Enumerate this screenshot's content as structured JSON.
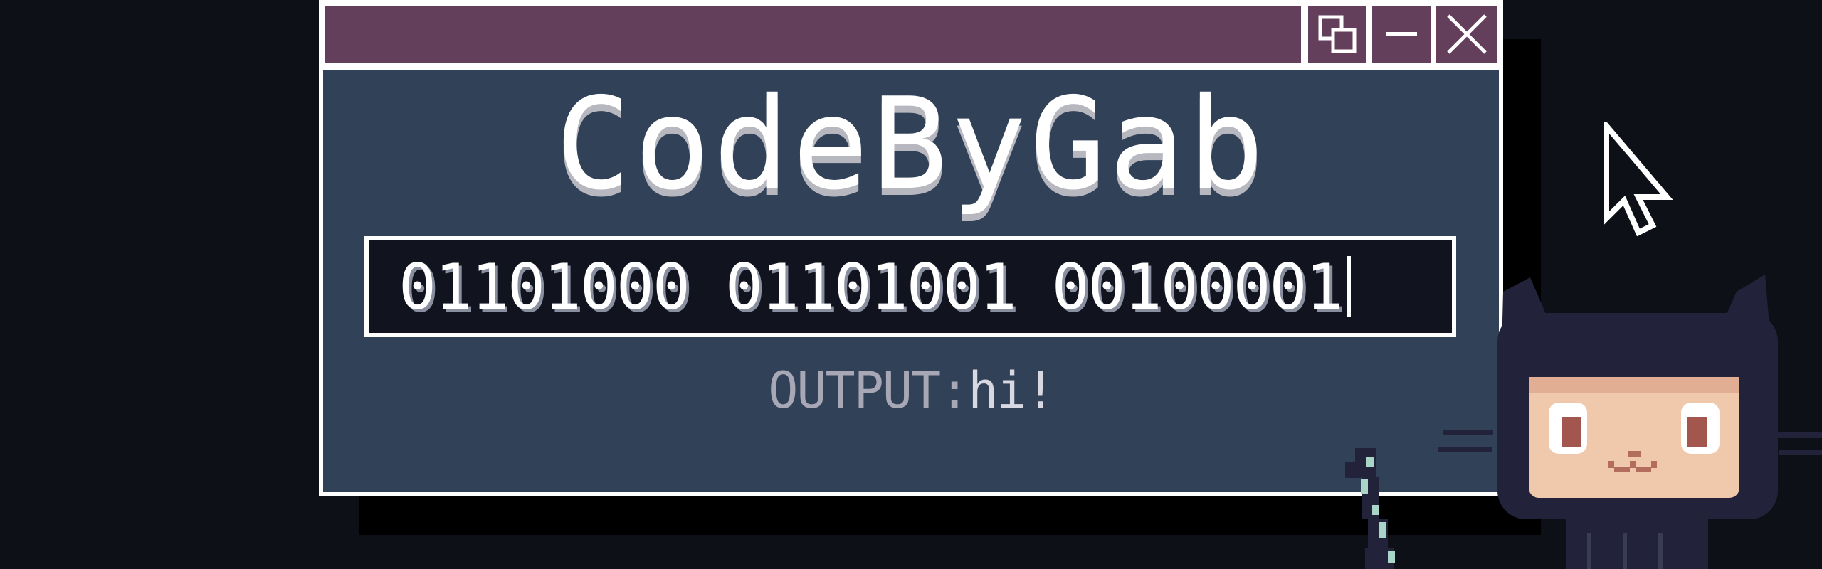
{
  "window": {
    "controls": {
      "restore": "restore-icon",
      "minimize": "minimize-icon",
      "close": "close-icon"
    }
  },
  "logo": {
    "text": "CodeByGab"
  },
  "input": {
    "value": "01101000 01101001 00100001"
  },
  "output": {
    "label": "OUTPUT:",
    "value": "hi!"
  },
  "colors": {
    "background": "#0d1117",
    "titlebar": "#633f5b",
    "window_body": "#314158",
    "input_bg": "#11141f",
    "text": "#ffffff",
    "output_text": "#a7a7b5"
  }
}
